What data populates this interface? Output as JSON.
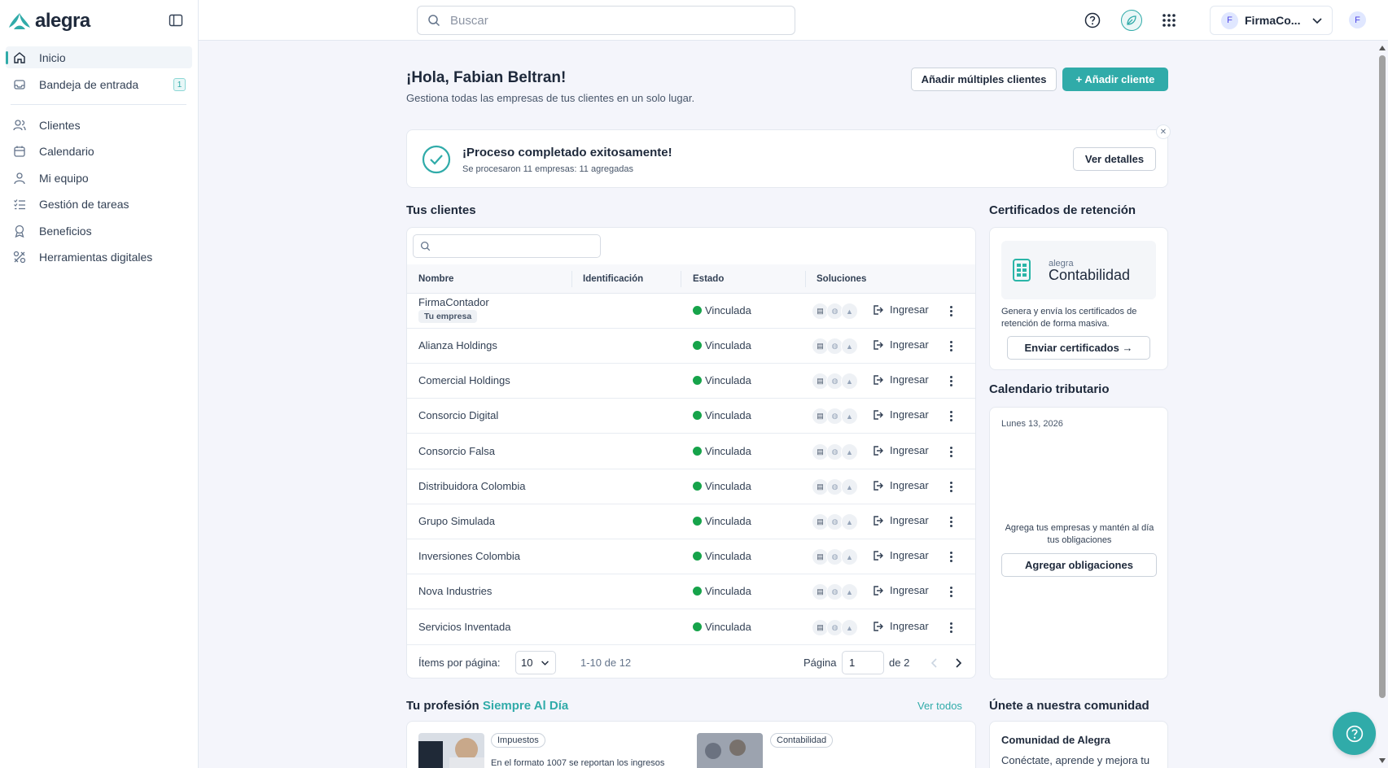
{
  "app": {
    "brand": "alegra",
    "accent_color": "#30aba9"
  },
  "sidebar": {
    "items": [
      {
        "label": "Inicio",
        "icon": "home-icon",
        "active": true
      },
      {
        "label": "Bandeja de entrada",
        "icon": "inbox-icon",
        "badge": "1"
      },
      {
        "label": "Clientes",
        "icon": "users-icon"
      },
      {
        "label": "Calendario",
        "icon": "calendar-icon"
      },
      {
        "label": "Mi equipo",
        "icon": "user-icon"
      },
      {
        "label": "Gestión de tareas",
        "icon": "tasks-icon"
      },
      {
        "label": "Beneficios",
        "icon": "award-icon"
      },
      {
        "label": "Herramientas digitales",
        "icon": "tools-icon"
      }
    ]
  },
  "topbar": {
    "search_placeholder": "Buscar",
    "company": {
      "initial": "F",
      "name": "FirmaCo..."
    },
    "user_initial": "F"
  },
  "header": {
    "greeting": "¡Hola, Fabian Beltran!",
    "subtitle": "Gestiona todas las empresas de tus clientes en un solo lugar.",
    "btn_multiple": "Añadir múltiples clientes",
    "btn_add": "+ Añadir cliente"
  },
  "success": {
    "title": "¡Proceso completado exitosamente!",
    "subtitle": "Se procesaron 11 empresas: 11 agregadas",
    "button": "Ver detalles"
  },
  "clients": {
    "title": "Tus clientes",
    "columns": [
      "Nombre",
      "Identificación",
      "Estado",
      "Soluciones"
    ],
    "own_tag": "Tu empresa",
    "action_label": "Ingresar",
    "rows": [
      {
        "name": "FirmaContador",
        "status": "Vinculada"
      },
      {
        "name": "Alianza Holdings",
        "status": "Vinculada"
      },
      {
        "name": "Comercial Holdings",
        "status": "Vinculada"
      },
      {
        "name": "Consorcio Digital",
        "status": "Vinculada"
      },
      {
        "name": "Consorcio Falsa",
        "status": "Vinculada"
      },
      {
        "name": "Distribuidora Colombia",
        "status": "Vinculada"
      },
      {
        "name": "Grupo Simulada",
        "status": "Vinculada"
      },
      {
        "name": "Inversiones Colombia",
        "status": "Vinculada"
      },
      {
        "name": "Nova Industries",
        "status": "Vinculada"
      },
      {
        "name": "Servicios Inventada",
        "status": "Vinculada"
      }
    ],
    "pagination": {
      "per_page_label": "Ítems por página:",
      "per_page": "10",
      "range": "1-10 de 12",
      "page_label": "Página",
      "page": "1",
      "of_label": "de 2"
    }
  },
  "certificates": {
    "title": "Certificados de retención",
    "logo_small": "alegra",
    "logo_big": "Contabilidad",
    "description": "Genera y envía los certificados de retención de forma masiva.",
    "button": "Enviar certificados →"
  },
  "calendar": {
    "title": "Calendario tributario",
    "date": "Lunes 13, 2026",
    "message": "Agrega tus empresas y mantén al día tus obligaciones",
    "button": "Agregar obligaciones"
  },
  "profession": {
    "title_prefix": "Tu profesión",
    "title_highlight": "Siempre Al Día",
    "see_all": "Ver todos",
    "articles": [
      {
        "tag": "Impuestos",
        "text": "En el formato 1007 se reportan los ingresos"
      },
      {
        "tag": "Contabilidad",
        "text": ""
      }
    ]
  },
  "community": {
    "title": "Únete a nuestra comunidad",
    "card_title": "Comunidad de Alegra",
    "card_text": "Conéctate, aprende y mejora tu"
  }
}
